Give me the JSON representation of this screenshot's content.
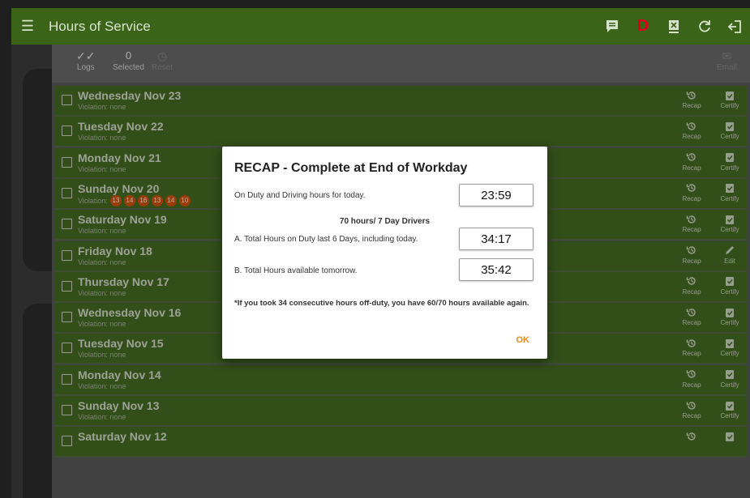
{
  "app": {
    "title": "Hours of Service"
  },
  "toolbar": {
    "logs_label": "Logs",
    "selected_count": "0",
    "selected_label": "Selected",
    "reset_label": "Reset",
    "email_label": "Email"
  },
  "rows": [
    {
      "day": "Wednesday Nov 23",
      "violation": "Violation: none",
      "right_label": "Certify"
    },
    {
      "day": "Tuesday Nov 22",
      "violation": "Violation: none",
      "right_label": "Certify"
    },
    {
      "day": "Monday Nov 21",
      "violation": "Violation: none",
      "right_label": "Certify"
    },
    {
      "day": "Sunday Nov 20",
      "violation": "Violation:",
      "right_label": "Certify",
      "badges": [
        "13",
        "14",
        "16",
        "13",
        "14",
        "10"
      ]
    },
    {
      "day": "Saturday Nov 19",
      "violation": "Violation: none",
      "right_label": "Certify"
    },
    {
      "day": "Friday Nov 18",
      "violation": "Violation: none",
      "right_label": "Edit"
    },
    {
      "day": "Thursday Nov 17",
      "violation": "Violation: none",
      "right_label": "Certify"
    },
    {
      "day": "Wednesday Nov 16",
      "violation": "Violation: none",
      "right_label": "Certify"
    },
    {
      "day": "Tuesday Nov 15",
      "violation": "Violation: none",
      "right_label": "Certify"
    },
    {
      "day": "Monday Nov 14",
      "violation": "Violation: none",
      "right_label": "Certify"
    },
    {
      "day": "Sunday Nov 13",
      "violation": "Violation: none",
      "right_label": "Certify"
    },
    {
      "day": "Saturday Nov 12",
      "violation": "",
      "right_label": ""
    }
  ],
  "recap_label": "Recap",
  "dialog": {
    "title": "RECAP - Complete at End of Workday",
    "on_duty_label": "On Duty and Driving hours for today.",
    "on_duty_value": "23:59",
    "subheading": "70 hours/ 7 Day Drivers",
    "total_a_label": "A. Total Hours on Duty last 6 Days, including today.",
    "total_a_value": "34:17",
    "total_b_label": "B. Total Hours available tomorrow.",
    "total_b_value": "35:42",
    "note": "*If you took 34 consecutive hours off-duty, you have 60/70 hours available again.",
    "ok_label": "OK"
  },
  "colors": {
    "appbar": "#3c6419",
    "row": "#466e23",
    "badge": "#d3540e",
    "ok": "#e88a17",
    "d_icon": "#e0001b"
  }
}
